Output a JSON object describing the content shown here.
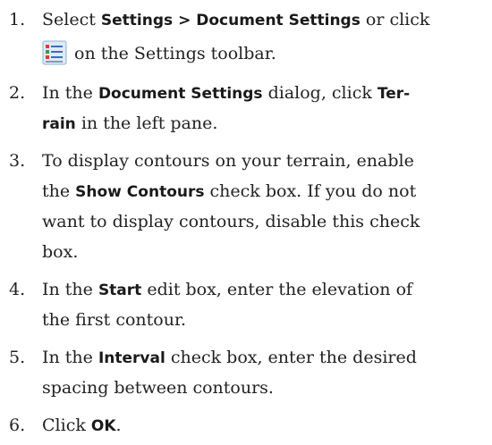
{
  "steps": [
    {
      "number": "1.",
      "lines": [
        [
          "Select ",
          "Settings > Document Settings",
          " or click"
        ],
        [
          "",
          "on the Settings toolbar."
        ]
      ]
    },
    {
      "number": "2.",
      "lines": [
        [
          "In the ",
          "Document Settings",
          " dialog, click ",
          "Ter-"
        ],
        [
          "rain",
          " in the left pane."
        ]
      ]
    },
    {
      "number": "3.",
      "lines": [
        [
          "To display contours on your terrain, enable"
        ],
        [
          "the ",
          "Show Contours",
          " check box. If you do not"
        ],
        [
          "want to display contours, disable this check"
        ],
        [
          "box."
        ]
      ]
    },
    {
      "number": "4.",
      "lines": [
        [
          "In the ",
          "Start",
          " edit box, enter the elevation of"
        ],
        [
          "the first contour."
        ]
      ]
    },
    {
      "number": "5.",
      "lines": [
        [
          "In the ",
          "Interval",
          " check box, enter the desired"
        ],
        [
          "spacing between contours."
        ]
      ]
    },
    {
      "number": "6.",
      "lines": [
        [
          "Click ",
          "OK",
          "."
        ]
      ]
    }
  ],
  "icon": "document-settings-icon"
}
